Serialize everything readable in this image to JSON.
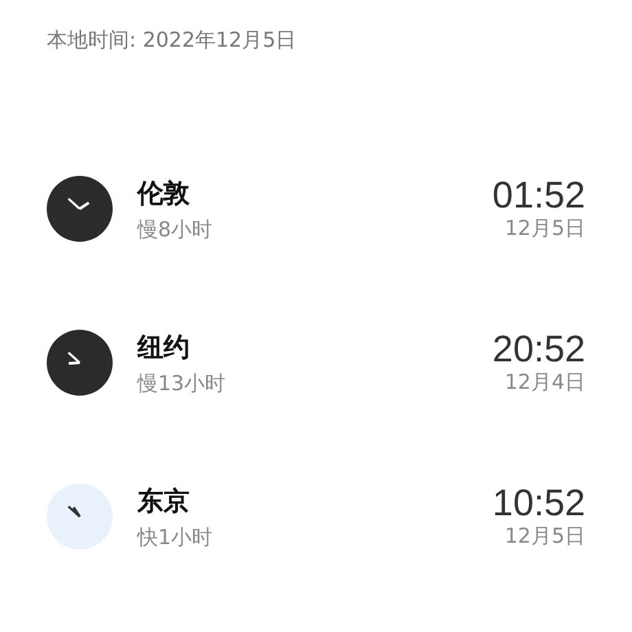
{
  "local_date": "本地时间: 2022年12月5日",
  "cities": [
    {
      "name": "伦敦",
      "offset": "慢8小时",
      "time": "01:52",
      "date": "12月5日",
      "kind": "dark"
    },
    {
      "name": "纽约",
      "offset": "慢13小时",
      "time": "20:52",
      "date": "12月4日",
      "kind": "dark"
    },
    {
      "name": "东京",
      "offset": "快1小时",
      "time": "10:52",
      "date": "12月5日",
      "kind": "light"
    }
  ]
}
